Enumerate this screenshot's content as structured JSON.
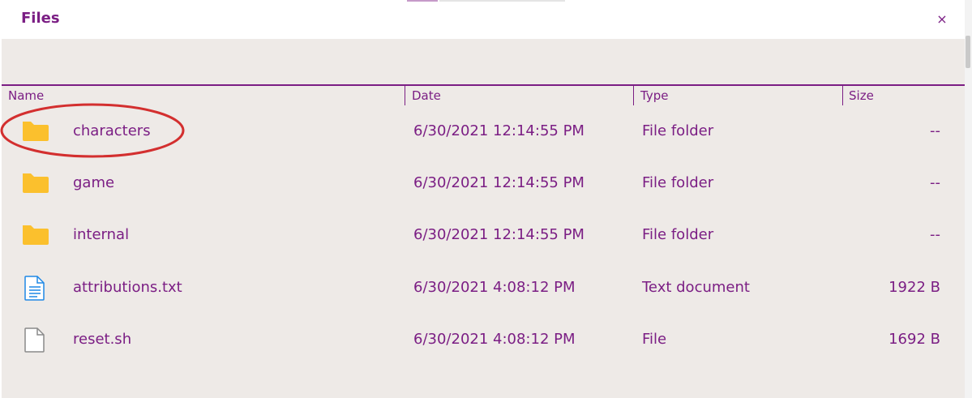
{
  "window": {
    "title": "Files",
    "close_label": "×"
  },
  "columns": {
    "name": "Name",
    "date": "Date",
    "type": "Type",
    "size": "Size"
  },
  "rows": [
    {
      "name": "characters",
      "date": "6/30/2021 12:14:55 PM",
      "type": "File folder",
      "size": "--",
      "icon": "folder-icon"
    },
    {
      "name": "game",
      "date": "6/30/2021 12:14:55 PM",
      "type": "File folder",
      "size": "--",
      "icon": "folder-icon"
    },
    {
      "name": "internal",
      "date": "6/30/2021 12:14:55 PM",
      "type": "File folder",
      "size": "--",
      "icon": "folder-icon"
    },
    {
      "name": "attributions.txt",
      "date": "6/30/2021 4:08:12 PM",
      "type": "Text document",
      "size": "1922 B",
      "icon": "text-document-icon"
    },
    {
      "name": "reset.sh",
      "date": "6/30/2021 4:08:12 PM",
      "type": "File",
      "size": "1692 B",
      "icon": "file-icon"
    }
  ],
  "colors": {
    "accent": "#7b1e84",
    "folder": "#fbc02d",
    "annotation": "#d32f2f",
    "background": "#eeeae7"
  }
}
